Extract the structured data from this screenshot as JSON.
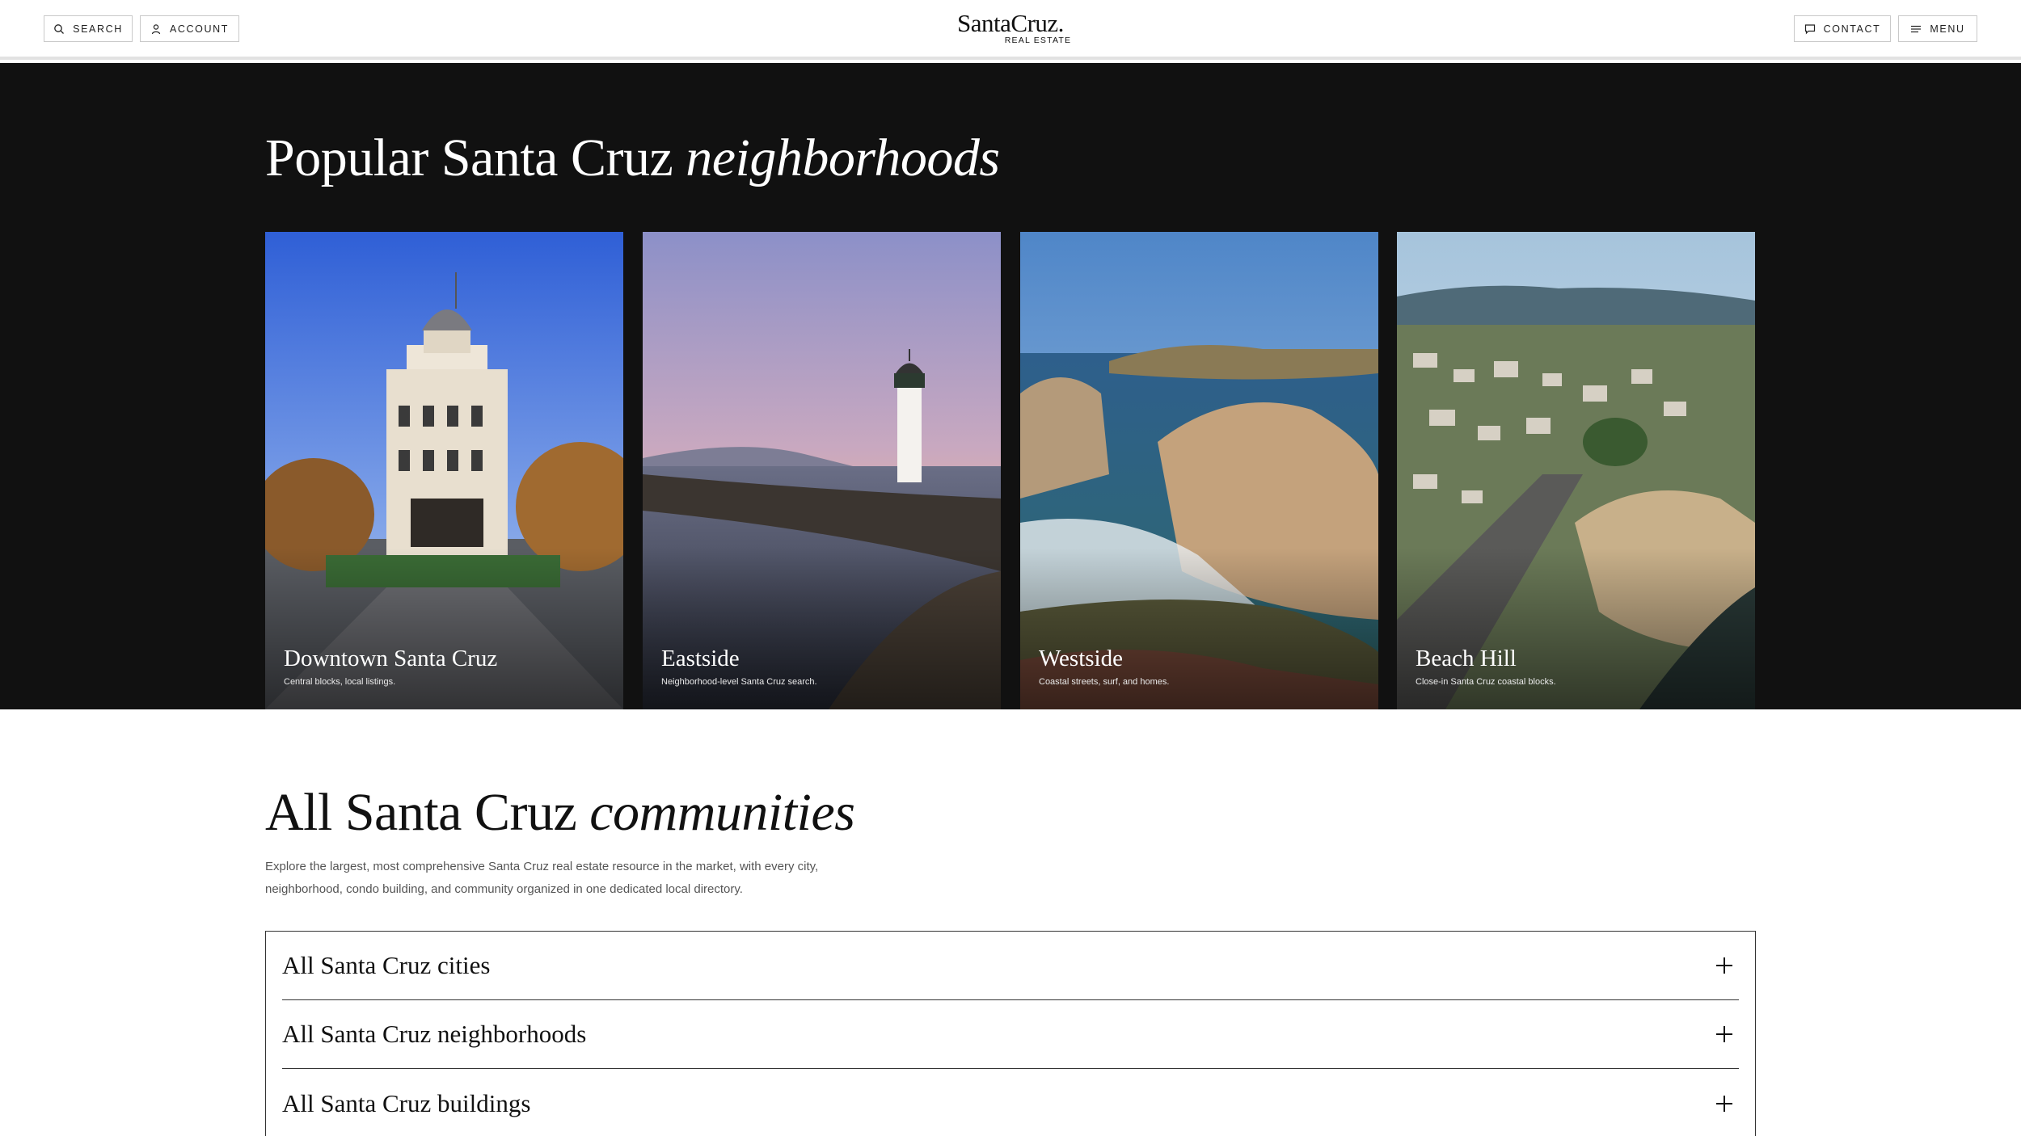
{
  "header": {
    "search_label": "SEARCH",
    "account_label": "ACCOUNT",
    "contact_label": "CONTACT",
    "menu_label": "MENU",
    "logo_main": "SantaCruz.",
    "logo_sub": "REAL ESTATE",
    "icons": {
      "search": "search-icon",
      "account": "user-icon",
      "contact": "chat-icon",
      "menu": "hamburger-icon"
    }
  },
  "popular": {
    "title_plain": "Popular Santa Cruz",
    "title_italic": "neighborhoods",
    "cards": [
      {
        "name": "Downtown Santa Cruz",
        "desc": "Central blocks, local listings."
      },
      {
        "name": "Eastside",
        "desc": "Neighborhood-level Santa Cruz search."
      },
      {
        "name": "Westside",
        "desc": "Coastal streets, surf, and homes."
      },
      {
        "name": "Beach Hill",
        "desc": "Close-in Santa Cruz coastal blocks."
      }
    ]
  },
  "communities": {
    "title_plain": "All Santa Cruz",
    "title_italic": "communities",
    "description": "Explore the largest, most comprehensive Santa Cruz real estate resource in the market, with every city, neighborhood, condo building, and community organized in one dedicated local directory.",
    "accordion": [
      {
        "label": "All Santa Cruz cities"
      },
      {
        "label": "All Santa Cruz neighborhoods"
      },
      {
        "label": "All Santa Cruz buildings"
      }
    ]
  },
  "colors": {
    "dark_bg": "#111111",
    "border": "#333333",
    "text_muted": "#555555"
  }
}
